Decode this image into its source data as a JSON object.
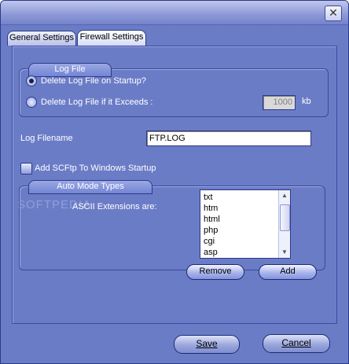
{
  "window": {
    "close_glyph": "✕"
  },
  "tabs": [
    {
      "label": "General Settings"
    },
    {
      "label": "Firewall Settings"
    }
  ],
  "log_file": {
    "group_label": "Log File",
    "option_delete_on_startup": "Delete Log File on Startup?",
    "option_delete_if_exceeds": "Delete Log File if it Exceeds :",
    "size_value": "1000",
    "size_unit": "kb"
  },
  "log_filename": {
    "label": "Log Filename",
    "value": "FTP.LOG"
  },
  "startup": {
    "label": "Add SCFtp To Windows Startup"
  },
  "watermark": "SOFTPEDIA",
  "auto_mode": {
    "group_label": "Auto Mode Types",
    "ascii_label": "ASCII Extensions are:",
    "extensions": [
      "txt",
      "htm",
      "html",
      "php",
      "cgi",
      "asp"
    ],
    "remove_label": "Remove",
    "add_label": "Add"
  },
  "footer": {
    "save_label": "Save",
    "cancel_label": "Cancel"
  }
}
